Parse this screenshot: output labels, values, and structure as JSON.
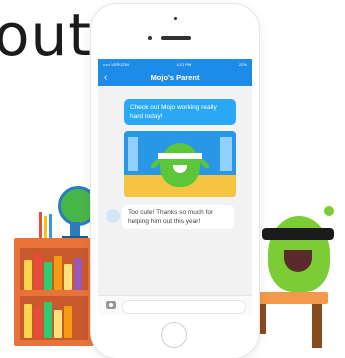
{
  "hero": {
    "text": "out"
  },
  "phone": {
    "status": {
      "carrier": "••••• VERIZON",
      "time": "4:21 PM",
      "battery": "22%"
    },
    "header": {
      "title": "Mojo's Parent",
      "back_icon": "chevron-left-icon"
    },
    "messages": [
      {
        "direction": "outgoing",
        "text": "Check out Mojo working really hard today!"
      },
      {
        "direction": "outgoing",
        "type": "photo"
      },
      {
        "direction": "incoming",
        "text": "Too cute! Thanks so much for helping him out this year!"
      }
    ],
    "composer": {
      "camera_icon": "camera-icon",
      "placeholder": ""
    }
  },
  "colors": {
    "accent": "#1d8be8",
    "bubble_out": "#29a9f5",
    "bubble_in": "#ffffff",
    "monster_green": "#7ccd35",
    "shelf_orange": "#e8733a"
  }
}
